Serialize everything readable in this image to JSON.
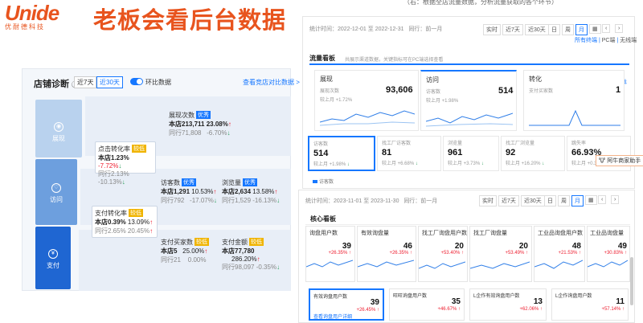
{
  "logo": {
    "mark": "Unide",
    "sub": "优耐德科技"
  },
  "headline": "老板会看后台数据",
  "topnote": "（右：根据全店流量数据，分析流量获取的各个环节）",
  "diag": {
    "title": "店铺诊断",
    "chips": [
      "近7天",
      "近30天"
    ],
    "toggle": "环比数据",
    "link": "查看竞店对比数据 >",
    "funnel": [
      "展现",
      "访问",
      "支付"
    ],
    "expo": {
      "label": "展现次数",
      "tag": "优秀",
      "main": "本店213,711",
      "pct": "23.08%",
      "peer": "同行71,808",
      "peer_pct": "-6.70%"
    },
    "ctr": {
      "label": "点击转化率",
      "tag": "较低",
      "main": "本店1.23%",
      "pct": "-7.72%",
      "peer": "同行2.13%",
      "peer_pct": "-10.13%"
    },
    "visitors": {
      "label": "访客数",
      "tag": "优秀",
      "main": "本店1,291",
      "pct": "10.53%",
      "peer": "同行792",
      "peer_pct": "-17.07%"
    },
    "views": {
      "label": "浏览量",
      "tag": "优秀",
      "main": "本店2,634",
      "pct": "13.58%",
      "peer": "同行1,529",
      "peer_pct": "-16.13%"
    },
    "paycr": {
      "label": "支付转化率",
      "tag": "较低",
      "main": "本店0.39%",
      "pct": "13.09%",
      "peer": "同行2.65%",
      "peer_pct": "20.45%"
    },
    "buyers": {
      "label": "支付买家数",
      "tag": "较低",
      "main": "本店5",
      "pct": "25.00%",
      "peer": "同行21",
      "peer_pct": "0.00%"
    },
    "amount": {
      "label": "支付金额",
      "tag": "较低",
      "main": "本店77,780",
      "pct": "286.20%",
      "peer": "同行98,097",
      "peer_pct": "-0.35%"
    }
  },
  "traffic": {
    "range": "统计时间：2022-12-01 至 2022-12-31",
    "peer": "同行：前一月",
    "buttons": [
      "实时",
      "近7天",
      "近30天",
      "日",
      "周",
      "月"
    ],
    "sub": [
      "所有终端",
      "PC端",
      "无线端"
    ],
    "title": "流量看板",
    "note": "共展示渠道数据，关键指标可在PC端选择查看",
    "big": [
      {
        "h": "展现",
        "s": "展现次数",
        "n": "93,606",
        "c": "较上月 +1.72%"
      },
      {
        "h": "访问",
        "s": "访客数",
        "n": "514",
        "c": "较上月 +1.98%"
      },
      {
        "h": "转化",
        "s": "支付买家数",
        "n": "1",
        "c": ""
      }
    ],
    "dl": "下载",
    "small": [
      {
        "s": "访客数",
        "n": "514",
        "c": "较上月 +1.98%"
      },
      {
        "s": "找工厂访客数",
        "n": "81",
        "c": "较上月 +6.68%"
      },
      {
        "s": "浏览量",
        "n": "961",
        "c": "较上月 +3.73%"
      },
      {
        "s": "找工厂浏览量",
        "n": "92",
        "c": "较上月 +16.20%"
      },
      {
        "s": "跳失率",
        "n": "66.93%",
        "c": "较上月 +0.3%"
      }
    ],
    "legend": "访客数",
    "assist": "阿牛商家助手"
  },
  "buyers": {
    "range": "统计时间：2023-11-01 至 2023-11-30",
    "peer": "同行：前一月",
    "buttons": [
      "实时",
      "近7天",
      "近30天",
      "日",
      "周",
      "月"
    ],
    "title": "核心看板",
    "cols": [
      {
        "h": "询盘用户数",
        "n": "39",
        "c": "+26.35%"
      },
      {
        "h": "有效询盘量",
        "n": "46",
        "c": "+26.35%"
      },
      {
        "h": "找工厂询盘用户数",
        "n": "20",
        "c": "+53.40%"
      },
      {
        "h": "找工厂询盘量",
        "n": "20",
        "c": "+53.49%"
      },
      {
        "h": "工业品询盘用户数",
        "n": "48",
        "c": "+21.53%"
      },
      {
        "h": "工业品询盘量",
        "n": "49",
        "c": "+30.83%"
      }
    ],
    "bottom": [
      {
        "h": "有效询盘用户数",
        "n": "39",
        "c": "+26.45%",
        "link": "查看询盘用户详细"
      },
      {
        "h": "旺旺询盘用户数",
        "n": "35",
        "c": "+46.67%"
      },
      {
        "h": "L企作有效询盘用户数",
        "n": "13",
        "c": "+62.06%"
      },
      {
        "h": "L企作询盘用户数",
        "n": "11",
        "c": "+57.14%"
      }
    ]
  }
}
